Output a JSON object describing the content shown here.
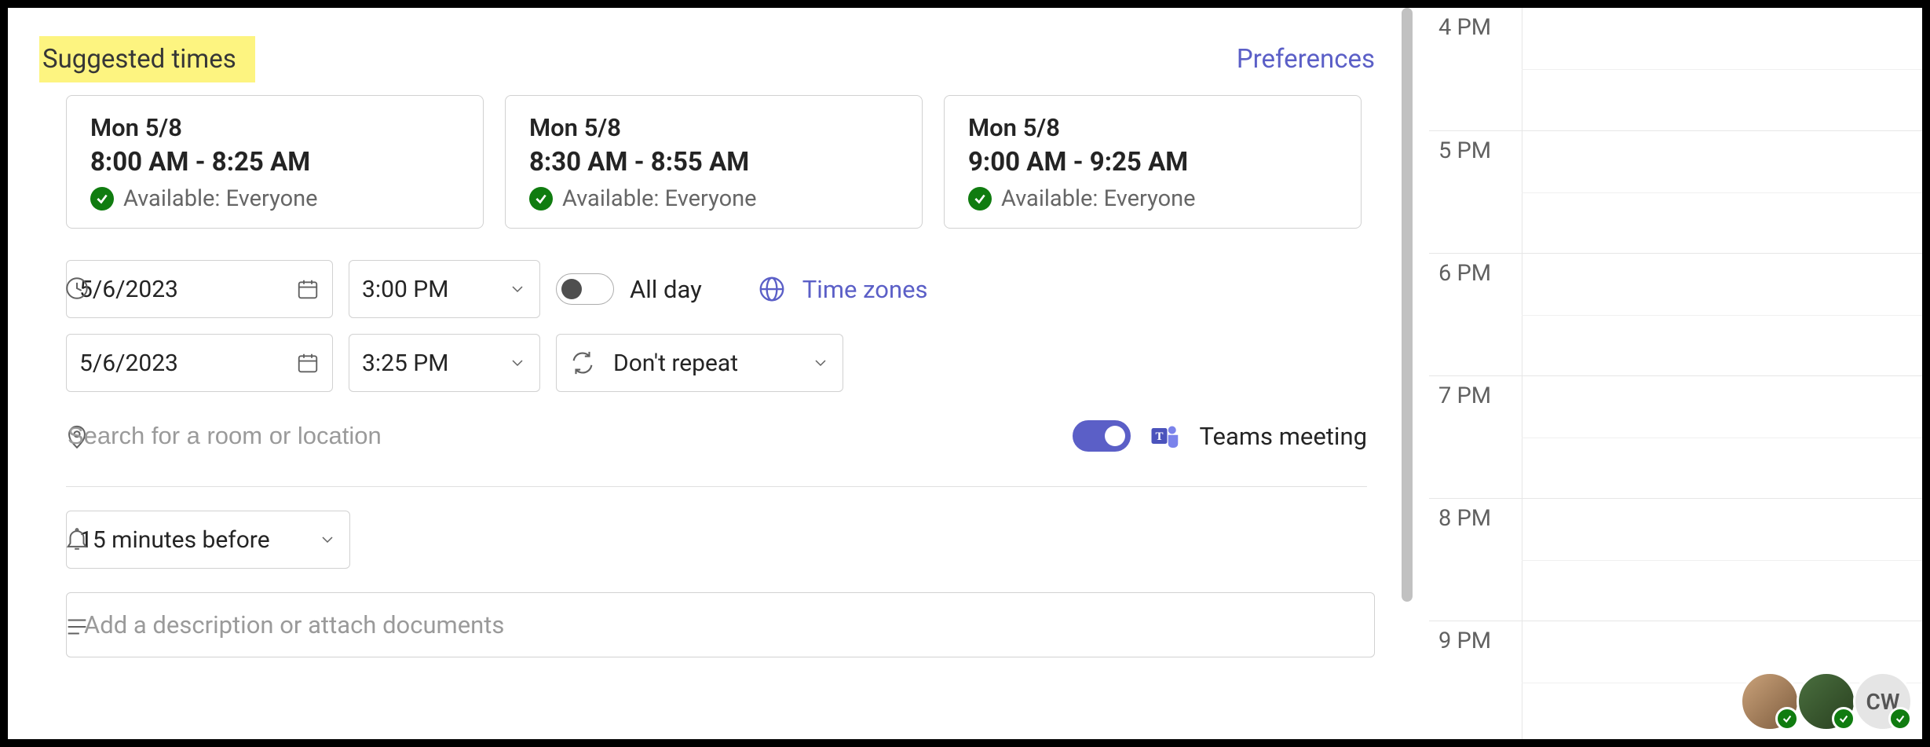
{
  "suggested": {
    "title": "Suggested times",
    "preferences": "Preferences",
    "cards": [
      {
        "date": "Mon 5/8",
        "time": "8:00 AM - 8:25 AM",
        "availability": "Available: Everyone"
      },
      {
        "date": "Mon 5/8",
        "time": "8:30 AM - 8:55 AM",
        "availability": "Available: Everyone"
      },
      {
        "date": "Mon 5/8",
        "time": "9:00 AM - 9:25 AM",
        "availability": "Available: Everyone"
      }
    ]
  },
  "datetime": {
    "start_date": "5/6/2023",
    "start_time": "3:00 PM",
    "end_date": "5/6/2023",
    "end_time": "3:25 PM",
    "all_day_label": "All day",
    "all_day_on": false,
    "time_zones_label": "Time zones",
    "repeat_label": "Don't repeat"
  },
  "location": {
    "placeholder": "Search for a room or location",
    "teams_label": "Teams meeting",
    "teams_on": true
  },
  "reminder": {
    "value": "15 minutes before"
  },
  "description": {
    "placeholder": "Add a description or attach documents"
  },
  "calendar_hours": [
    "4 PM",
    "5 PM",
    "6 PM",
    "7 PM",
    "8 PM",
    "9 PM"
  ],
  "presence": {
    "avatars": [
      {
        "initials": "",
        "variant": "a1"
      },
      {
        "initials": "",
        "variant": "a2"
      },
      {
        "initials": "CW",
        "variant": "a3"
      }
    ]
  },
  "colors": {
    "accent": "#5b5fc7",
    "success": "#107c10",
    "highlight": "#fdf480"
  }
}
